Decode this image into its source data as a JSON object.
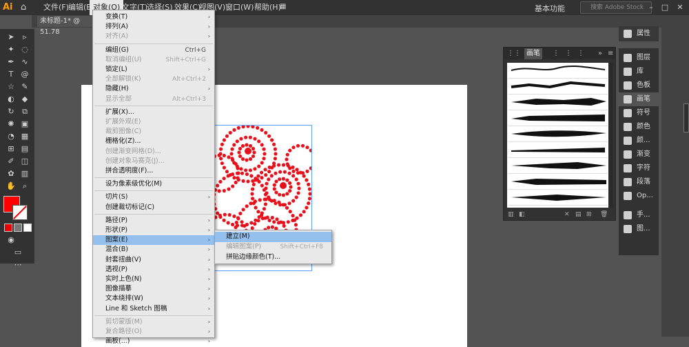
{
  "app": {
    "logo": "Ai",
    "home_icon": "home-icon"
  },
  "menubar": {
    "items": [
      "文件(F)",
      "编辑(E)",
      "对象(O)",
      "文字(T)",
      "选择(S)",
      "效果(C)",
      "视图(V)",
      "窗口(W)",
      "帮助(H)"
    ],
    "active_index": 2,
    "workspace": "基本功能",
    "search_placeholder": "搜索 Adobe Stock"
  },
  "document": {
    "tab_title": "未标题-1* @ 51.78"
  },
  "object_menu": {
    "items": [
      {
        "label": "变换(T)",
        "shortcut": "",
        "submenu": true,
        "disabled": false
      },
      {
        "label": "排列(A)",
        "shortcut": "",
        "submenu": true,
        "disabled": false
      },
      {
        "label": "对齐(A)",
        "shortcut": "",
        "submenu": true,
        "disabled": true
      },
      {
        "sep": true
      },
      {
        "label": "编组(G)",
        "shortcut": "Ctrl+G",
        "submenu": false,
        "disabled": false
      },
      {
        "label": "取消编组(U)",
        "shortcut": "Shift+Ctrl+G",
        "submenu": false,
        "disabled": true
      },
      {
        "label": "锁定(L)",
        "shortcut": "",
        "submenu": true,
        "disabled": false
      },
      {
        "label": "全部解锁(K)",
        "shortcut": "Alt+Ctrl+2",
        "submenu": false,
        "disabled": true
      },
      {
        "label": "隐藏(H)",
        "shortcut": "",
        "submenu": true,
        "disabled": false
      },
      {
        "label": "显示全部",
        "shortcut": "Alt+Ctrl+3",
        "submenu": false,
        "disabled": true
      },
      {
        "sep": true
      },
      {
        "label": "扩展(X)...",
        "shortcut": "",
        "submenu": false,
        "disabled": false
      },
      {
        "label": "扩展外观(E)",
        "shortcut": "",
        "submenu": false,
        "disabled": true
      },
      {
        "label": "裁剪图像(C)",
        "shortcut": "",
        "submenu": false,
        "disabled": true
      },
      {
        "label": "栅格化(Z)...",
        "shortcut": "",
        "submenu": false,
        "disabled": false
      },
      {
        "label": "创建渐变网格(D)...",
        "shortcut": "",
        "submenu": false,
        "disabled": true
      },
      {
        "label": "创建对象马赛克(J)...",
        "shortcut": "",
        "submenu": false,
        "disabled": true
      },
      {
        "label": "拼合透明度(F)...",
        "shortcut": "",
        "submenu": false,
        "disabled": false
      },
      {
        "sep": true
      },
      {
        "label": "设为像素级优化(M)",
        "shortcut": "",
        "submenu": false,
        "disabled": false
      },
      {
        "sep": true
      },
      {
        "label": "切片(S)",
        "shortcut": "",
        "submenu": true,
        "disabled": false
      },
      {
        "label": "创建裁切标记(C)",
        "shortcut": "",
        "submenu": false,
        "disabled": false
      },
      {
        "sep": true
      },
      {
        "label": "路径(P)",
        "shortcut": "",
        "submenu": true,
        "disabled": false
      },
      {
        "label": "形状(P)",
        "shortcut": "",
        "submenu": true,
        "disabled": false
      },
      {
        "label": "图案(E)",
        "shortcut": "",
        "submenu": true,
        "disabled": false,
        "highlight": true
      },
      {
        "label": "混合(B)",
        "shortcut": "",
        "submenu": true,
        "disabled": false
      },
      {
        "label": "封套扭曲(V)",
        "shortcut": "",
        "submenu": true,
        "disabled": false
      },
      {
        "label": "透视(P)",
        "shortcut": "",
        "submenu": true,
        "disabled": false
      },
      {
        "label": "实时上色(N)",
        "shortcut": "",
        "submenu": true,
        "disabled": false
      },
      {
        "label": "图像描摹",
        "shortcut": "",
        "submenu": true,
        "disabled": false
      },
      {
        "label": "文本绕排(W)",
        "shortcut": "",
        "submenu": true,
        "disabled": false
      },
      {
        "label": "Line 和 Sketch 图稿",
        "shortcut": "",
        "submenu": true,
        "disabled": false
      },
      {
        "sep": true
      },
      {
        "label": "剪切蒙版(M)",
        "shortcut": "",
        "submenu": true,
        "disabled": true
      },
      {
        "label": "复合路径(O)",
        "shortcut": "",
        "submenu": true,
        "disabled": true
      },
      {
        "label": "画板(...)",
        "shortcut": "",
        "submenu": true,
        "disabled": false
      }
    ]
  },
  "pattern_submenu": {
    "items": [
      {
        "label": "建立(M)",
        "shortcut": "",
        "disabled": false,
        "highlight": true
      },
      {
        "label": "编辑图案(P)",
        "shortcut": "Shift+Ctrl+F8",
        "disabled": true,
        "highlight": false
      },
      {
        "label": "拼贴边缘颜色(T)...",
        "shortcut": "",
        "disabled": false,
        "highlight": false
      }
    ]
  },
  "brush_panel": {
    "tabs": [
      "画笔"
    ],
    "active_tab": "画笔",
    "brush_count": 9
  },
  "right_dock": {
    "top": [
      {
        "label": "属性",
        "icon": "properties-icon"
      }
    ],
    "items": [
      {
        "label": "图层",
        "icon": "layers-icon"
      },
      {
        "label": "库",
        "icon": "library-icon"
      },
      {
        "label": "色板",
        "icon": "swatches-icon"
      },
      {
        "label": "画笔",
        "icon": "brush-icon",
        "active": true
      },
      {
        "label": "符号",
        "icon": "symbols-icon"
      },
      {
        "label": "颜色",
        "icon": "color-icon"
      },
      {
        "label": "颜...",
        "icon": "color-guide-icon"
      },
      {
        "label": "渐变",
        "icon": "gradient-icon"
      },
      {
        "label": "字符",
        "icon": "character-icon"
      },
      {
        "label": "段落",
        "icon": "paragraph-icon"
      },
      {
        "label": "Op...",
        "icon": "opentype-icon"
      },
      {
        "label": "手...",
        "icon": "hand-icon"
      },
      {
        "label": "图...",
        "icon": "image-icon"
      }
    ]
  },
  "colors": {
    "fill": "#ff0000",
    "pattern": "#e8101a",
    "highlight": "#93c0ec"
  }
}
